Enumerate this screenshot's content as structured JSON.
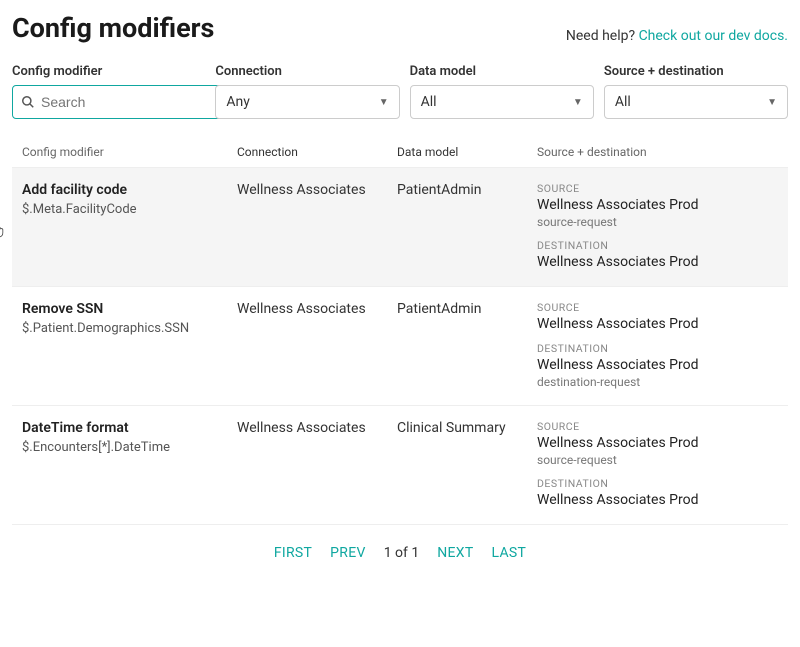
{
  "header": {
    "title": "Config modifiers",
    "help_prefix": "Need help? ",
    "help_link": "Check out our dev docs."
  },
  "filters": {
    "config_modifier": {
      "label": "Config modifier",
      "placeholder": "Search",
      "value": ""
    },
    "connection": {
      "label": "Connection",
      "value": "Any"
    },
    "data_model": {
      "label": "Data model",
      "value": "All"
    },
    "source_dest": {
      "label": "Source + destination",
      "value": "All"
    }
  },
  "columns": {
    "mod": "Config modifier",
    "conn": "Connection",
    "dm": "Data model",
    "sd": "Source + destination"
  },
  "sd_labels": {
    "source": "SOURCE",
    "destination": "DESTINATION"
  },
  "rows": [
    {
      "name": "Add facility code",
      "path": "$.Meta.FacilityCode",
      "connection": "Wellness Associates",
      "data_model": "PatientAdmin",
      "source": {
        "value": "Wellness Associates Prod",
        "sub": "source-request"
      },
      "destination": {
        "value": "Wellness Associates Prod",
        "sub": ""
      },
      "hovered": true
    },
    {
      "name": "Remove SSN",
      "path": "$.Patient.Demographics.SSN",
      "connection": "Wellness Associates",
      "data_model": "PatientAdmin",
      "source": {
        "value": "Wellness Associates Prod",
        "sub": ""
      },
      "destination": {
        "value": "Wellness Associates Prod",
        "sub": "destination-request"
      },
      "hovered": false
    },
    {
      "name": "DateTime format",
      "path": "$.Encounters[*].DateTime",
      "connection": "Wellness Associates",
      "data_model": "Clinical Summary",
      "source": {
        "value": "Wellness Associates Prod",
        "sub": "source-request"
      },
      "destination": {
        "value": "Wellness Associates Prod",
        "sub": ""
      },
      "hovered": false
    }
  ],
  "pagination": {
    "first": "FIRST",
    "prev": "PREV",
    "info": "1 of 1",
    "next": "NEXT",
    "last": "LAST"
  }
}
